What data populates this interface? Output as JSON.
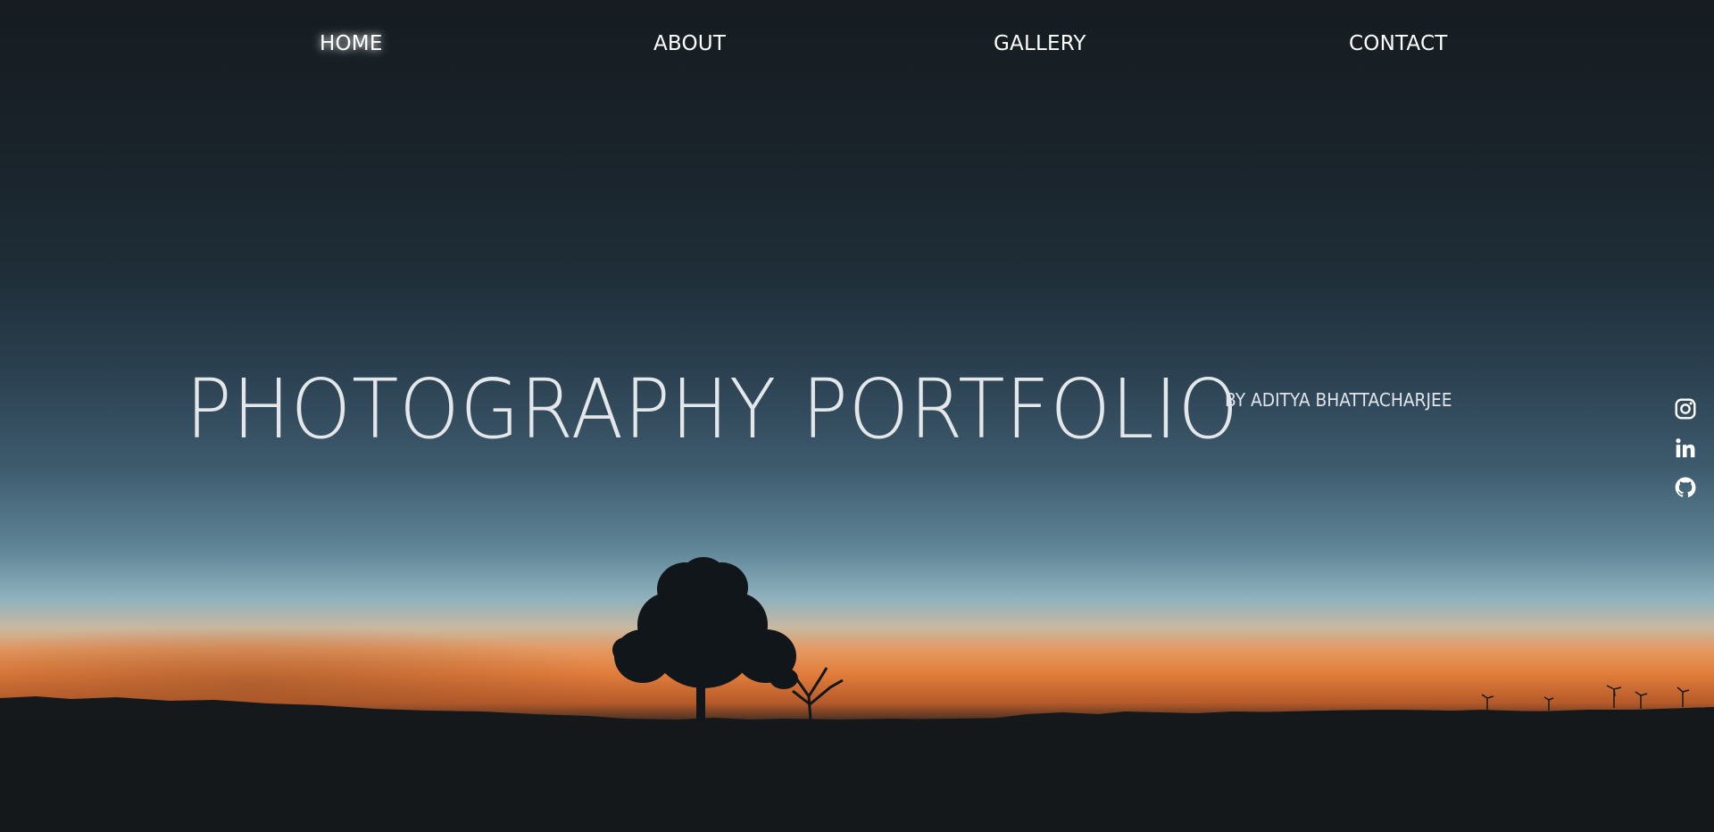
{
  "nav": {
    "items": [
      {
        "label": "HOME",
        "active": true
      },
      {
        "label": "ABOUT",
        "active": false
      },
      {
        "label": "GALLERY",
        "active": false
      },
      {
        "label": "CONTACT",
        "active": false
      }
    ]
  },
  "hero": {
    "title": "PHOTOGRAPHY PORTFOLIO",
    "subtitle": "BY ADITYA BHATTACHARJEE"
  },
  "social": {
    "icons": [
      "instagram-icon",
      "linkedin-icon",
      "github-icon"
    ]
  },
  "colors": {
    "text": "#ffffff",
    "title": "#e3e7ea",
    "sky_top": "#161c21",
    "horizon_orange": "#e27d3c",
    "ground": "#14181b"
  }
}
